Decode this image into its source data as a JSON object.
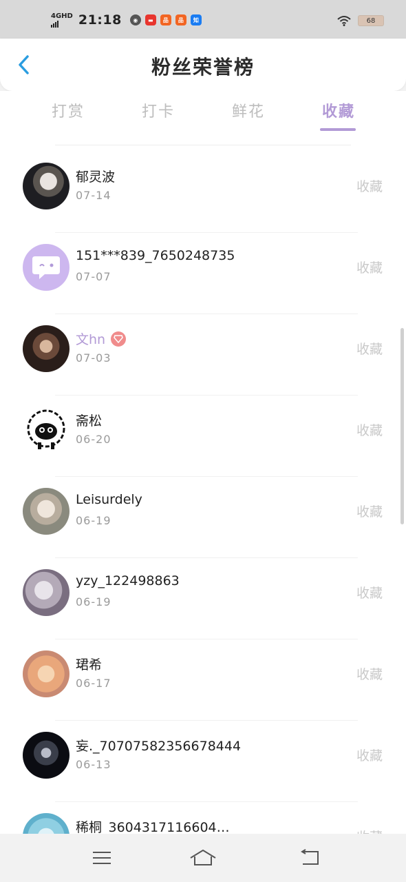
{
  "status_bar": {
    "network": "4GHD",
    "time": "21:18",
    "app_icons": [
      "qq-icon",
      "toutiao-icon",
      "taobao-icon",
      "taobao-icon",
      "zhihu-icon"
    ],
    "battery": "68"
  },
  "header": {
    "title": "粉丝荣誉榜",
    "back_icon": "chevron-left-icon"
  },
  "tabs": [
    {
      "label": "打赏",
      "active": false
    },
    {
      "label": "打卡",
      "active": false
    },
    {
      "label": "鲜花",
      "active": false
    },
    {
      "label": "收藏",
      "active": true
    }
  ],
  "list": [
    {
      "name": "郁灵波",
      "date": "07-14",
      "action": "收藏",
      "vip": false
    },
    {
      "name": "151***839_7650248735",
      "date": "07-07",
      "action": "收藏",
      "vip": false
    },
    {
      "name": "文hn",
      "date": "07-03",
      "action": "收藏",
      "vip": true
    },
    {
      "name": "斋松",
      "date": "06-20",
      "action": "收藏",
      "vip": false
    },
    {
      "name": "Leisurdely",
      "date": "06-19",
      "action": "收藏",
      "vip": false
    },
    {
      "name": "yzy_122498863",
      "date": "06-19",
      "action": "收藏",
      "vip": false
    },
    {
      "name": "珺希",
      "date": "06-17",
      "action": "收藏",
      "vip": false
    },
    {
      "name": "妄._70707582356678444",
      "date": "06-13",
      "action": "收藏",
      "vip": false
    },
    {
      "name": "稀桐_3604317116604…",
      "date": "",
      "action": "收藏",
      "vip": false
    }
  ],
  "nav_bar": {
    "buttons": [
      "menu-icon",
      "home-icon",
      "back-icon"
    ]
  },
  "colors": {
    "accent": "#b29ad6",
    "muted": "#c9c9c9",
    "vip_badge": "#f08c8c"
  }
}
